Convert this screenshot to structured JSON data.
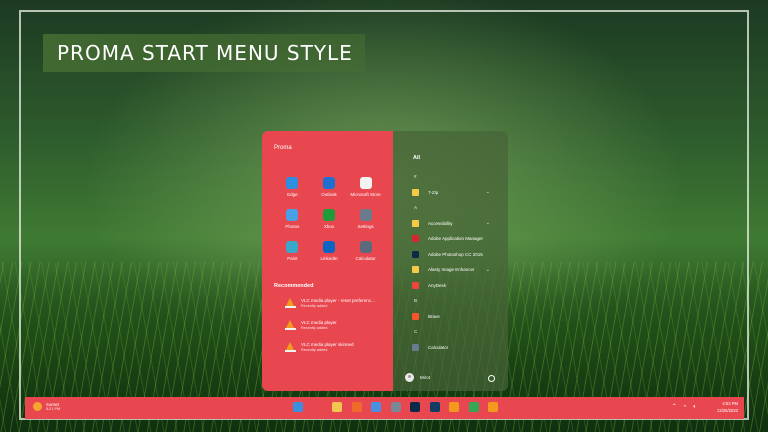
{
  "banner": {
    "title": "PROMA START MENU STYLE"
  },
  "start_menu": {
    "title": "Proma",
    "pinned": [
      {
        "label": "Edge",
        "icon": "edge-icon",
        "color": "#2e8ee0"
      },
      {
        "label": "Outlook",
        "icon": "outlook-icon",
        "color": "#1f6fd0"
      },
      {
        "label": "Microsoft Store",
        "icon": "store-icon",
        "color": "#f3f3f3"
      },
      {
        "label": "Photos",
        "icon": "photos-icon",
        "color": "#4aa0e6"
      },
      {
        "label": "Xbox",
        "icon": "xbox-icon",
        "color": "#1e9c3a"
      },
      {
        "label": "Settings",
        "icon": "gear-icon",
        "color": "#6b7a8c"
      },
      {
        "label": "Paint",
        "icon": "paint-icon",
        "color": "#3aa6c8"
      },
      {
        "label": "LinkedIn",
        "icon": "linkedin-icon",
        "color": "#0a66c2"
      },
      {
        "label": "Calculator",
        "icon": "calculator-icon",
        "color": "#5b6b7e"
      }
    ],
    "recommended_title": "Recommended",
    "recommended": [
      {
        "title": "VLC media player - reset preferenc...",
        "subtitle": "Recently added"
      },
      {
        "title": "VLC media player",
        "subtitle": "Recently added"
      },
      {
        "title": "VLC media player skinned",
        "subtitle": "Recently added"
      }
    ],
    "all_title": "All",
    "all_apps": [
      {
        "kind": "letter",
        "label": "#"
      },
      {
        "kind": "folder",
        "label": "7-Zip",
        "chevron": "⌄"
      },
      {
        "kind": "letter",
        "label": "A"
      },
      {
        "kind": "folder",
        "label": "Accessibility",
        "chevron": "⌄"
      },
      {
        "kind": "app",
        "label": "Adobe Application Manager",
        "color": "#d8262e"
      },
      {
        "kind": "app",
        "label": "Adobe Photoshop CC 2015",
        "color": "#0b2a4a"
      },
      {
        "kind": "folder",
        "label": "Alasty Image Enhancer",
        "chevron": "⌄"
      },
      {
        "kind": "app",
        "label": "AnyDesk",
        "color": "#ef443b"
      },
      {
        "kind": "letter",
        "label": "B"
      },
      {
        "kind": "app",
        "label": "Brave",
        "color": "#fb542b"
      },
      {
        "kind": "letter",
        "label": "C"
      },
      {
        "kind": "app",
        "label": "Calculator",
        "color": "#6a7b8e"
      }
    ],
    "user": {
      "name": "Mirot"
    }
  },
  "taskbar": {
    "weather": {
      "line1": "Sunset",
      "line2": "5:21 PM"
    },
    "apps": [
      {
        "name": "start-icon",
        "color": "#3b8fe0"
      },
      {
        "name": "search-icon",
        "color": "#e8474f"
      },
      {
        "name": "file-explorer-icon",
        "color": "#f3c74f"
      },
      {
        "name": "firefox-icon",
        "color": "#f06a2c"
      },
      {
        "name": "store-icon",
        "color": "#4a90e2"
      },
      {
        "name": "settings-icon",
        "color": "#7b8794"
      },
      {
        "name": "photoshop-icon",
        "color": "#0b2a4a"
      },
      {
        "name": "photoshop-alt-icon",
        "color": "#133c64"
      },
      {
        "name": "vlc-icon",
        "color": "#f39a1e"
      },
      {
        "name": "chrome-icon",
        "color": "#34a853"
      },
      {
        "name": "vlc-alt-icon",
        "color": "#f39a1e"
      }
    ],
    "clock": {
      "time": "4:53 PM",
      "date": "12/25/2023"
    }
  }
}
